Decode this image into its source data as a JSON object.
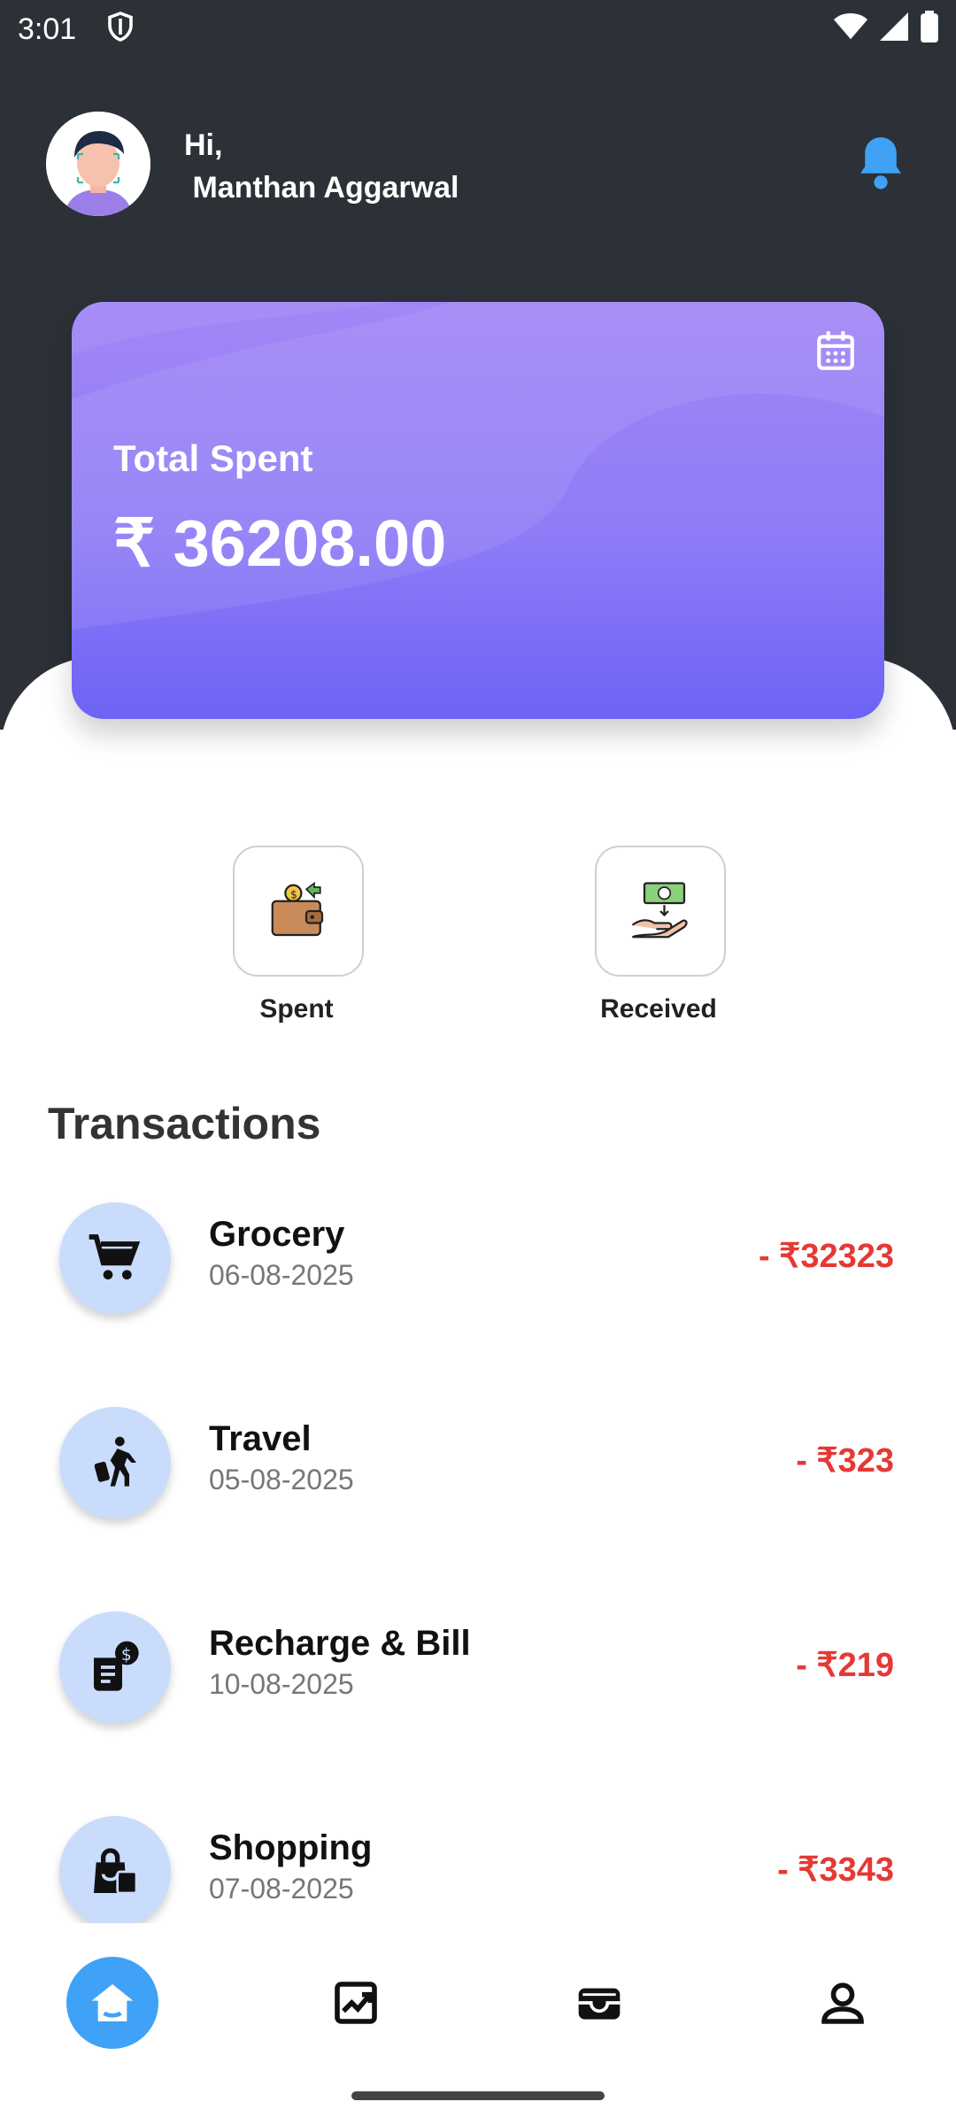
{
  "status_bar": {
    "time": "3:01"
  },
  "header": {
    "greeting_hi": "Hi,",
    "user_name": "Manthan Aggarwal"
  },
  "card": {
    "title": "Total Spent",
    "amount": "₹ 36208.00"
  },
  "quick_actions": [
    {
      "label": "Spent",
      "icon": "wallet-icon"
    },
    {
      "label": "Received",
      "icon": "receive-money-icon"
    }
  ],
  "transactions_title": "Transactions",
  "transactions": [
    {
      "name": "Grocery",
      "date": "06-08-2025",
      "amount": "- ₹32323",
      "icon": "cart-icon"
    },
    {
      "name": "Travel",
      "date": "05-08-2025",
      "amount": "- ₹323",
      "icon": "traveler-icon"
    },
    {
      "name": "Recharge & Bill",
      "date": "10-08-2025",
      "amount": "- ₹219",
      "icon": "bill-icon"
    },
    {
      "name": "Shopping",
      "date": "07-08-2025",
      "amount": "- ₹3343",
      "icon": "shopping-bag-icon"
    }
  ],
  "nav": [
    "home-icon",
    "chart-icon",
    "wallet-icon",
    "profile-icon"
  ],
  "colors": {
    "header_bg": "#2b3136",
    "accent": "#3fa2f7",
    "card_start": "#a286f6",
    "card_end": "#6d63f5",
    "debit": "#e53935"
  }
}
